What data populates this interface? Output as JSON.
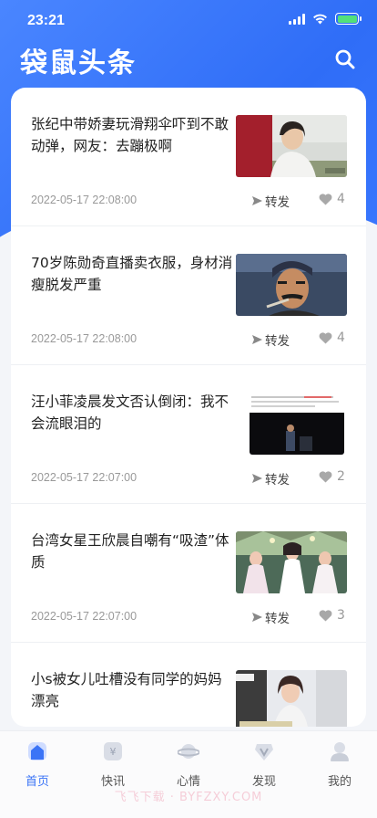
{
  "status_bar": {
    "time": "23:21"
  },
  "header": {
    "app_title": "袋鼠头条",
    "search_icon": "search-icon"
  },
  "colors": {
    "brand": "#3b74f6",
    "like": "#999999"
  },
  "news": [
    {
      "title": "张纪中带娇妻玩滑翔伞吓到不敢动弹，网友：去蹦极啊",
      "date": "2022-05-17 22:08:00",
      "forward_label": "转发",
      "likes": "4",
      "thumb_icon": "photo-woman-in-car"
    },
    {
      "title": "70岁陈勋奇直播卖衣服，身材消瘦脱发严重",
      "date": "2022-05-17 22:08:00",
      "forward_label": "转发",
      "likes": "4",
      "thumb_icon": "photo-man-with-cigar"
    },
    {
      "title": "汪小菲凌晨发文否认倒闭：我不会流眼泪的",
      "date": "2022-05-17 22:07:00",
      "forward_label": "转发",
      "likes": "2",
      "thumb_icon": "photo-screenshot-post"
    },
    {
      "title": "台湾女星王欣晨自嘲有“吸渣”体质",
      "date": "2022-05-17 22:07:00",
      "forward_label": "转发",
      "likes": "3",
      "thumb_icon": "photo-stage-performance"
    },
    {
      "title": "小s被女儿吐槽没有同学的妈妈漂亮",
      "date": "",
      "forward_label": "",
      "likes": "",
      "thumb_icon": "photo-tv-show"
    }
  ],
  "tabs": [
    {
      "label": "首页",
      "icon": "home-icon",
      "active": true
    },
    {
      "label": "快讯",
      "icon": "flash-news-icon",
      "active": false
    },
    {
      "label": "心情",
      "icon": "mood-planet-icon",
      "active": false
    },
    {
      "label": "发现",
      "icon": "discover-icon",
      "active": false
    },
    {
      "label": "我的",
      "icon": "profile-icon",
      "active": false
    }
  ],
  "watermark": "飞飞下载 · BYFZXY.COM"
}
